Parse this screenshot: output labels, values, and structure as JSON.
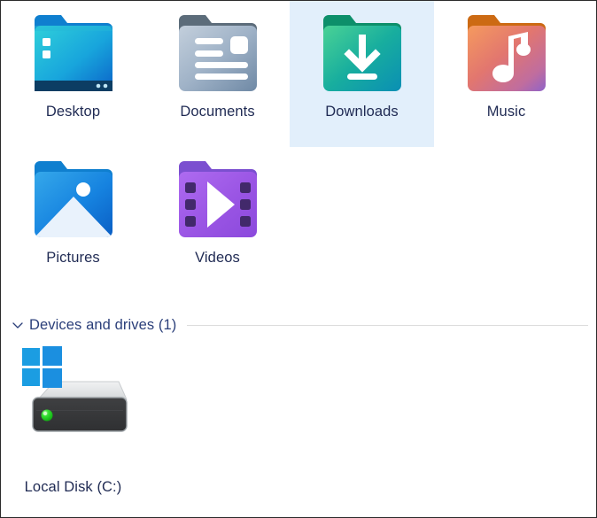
{
  "window": {
    "view": "file-explorer-content-pane",
    "background_color": "#ffffff",
    "border_color": "#2b2b2b"
  },
  "folders": {
    "selection_color": "#e2effb",
    "label_color": "#1f2a53",
    "rows": [
      [
        {
          "label": "Desktop",
          "icon": "folder-desktop-icon",
          "selected": false,
          "colors": {
            "tab": "#0f7fcf",
            "body_start": "#2ec8d8",
            "body_end": "#0a6fd0",
            "accent": "#0c3d63"
          }
        },
        {
          "label": "Documents",
          "icon": "folder-documents-icon",
          "selected": false,
          "colors": {
            "tab": "#5c6c7a",
            "body_start": "#b9c6d6",
            "body_end": "#7d94ad",
            "accent": "#ffffff"
          }
        },
        {
          "label": "Downloads",
          "icon": "folder-downloads-icon",
          "selected": true,
          "colors": {
            "tab": "#0d8f6a",
            "body_start": "#3fc78f",
            "body_end": "#0b93ab",
            "accent": "#ffffff"
          }
        },
        {
          "label": "Music",
          "icon": "folder-music-icon",
          "selected": false,
          "colors": {
            "tab": "#cc6a13",
            "body_start": "#f29052",
            "body_end": "#9b6fc4",
            "accent": "#ffffff"
          }
        }
      ],
      [
        {
          "label": "Pictures",
          "icon": "folder-pictures-icon",
          "selected": false,
          "colors": {
            "tab": "#0f7fcf",
            "body_start": "#2f9fe8",
            "body_end": "#0a64c8",
            "accent": "#e8f1fb"
          }
        },
        {
          "label": "Videos",
          "icon": "folder-videos-icon",
          "selected": false,
          "colors": {
            "tab": "#7b4fd0",
            "body_start": "#a35fe8",
            "body_end": "#8a4fd8",
            "accent": "#3c2066"
          }
        }
      ]
    ]
  },
  "devices_section": {
    "chevron_icon": "chevron-down-icon",
    "title": "Devices and drives (1)",
    "title_color": "#2b3f7a",
    "rule_color": "#dcdcdc",
    "items": [
      {
        "label": "Local Disk (C:)",
        "icon": "local-disk-drive-icon",
        "badge_icon": "windows-logo-icon",
        "selected": false,
        "colors": {
          "windows_blue": "#1b9de2",
          "drive_top": "#e3e5e6",
          "drive_front": "#3a3a3a",
          "led": "#22d427"
        }
      }
    ]
  }
}
